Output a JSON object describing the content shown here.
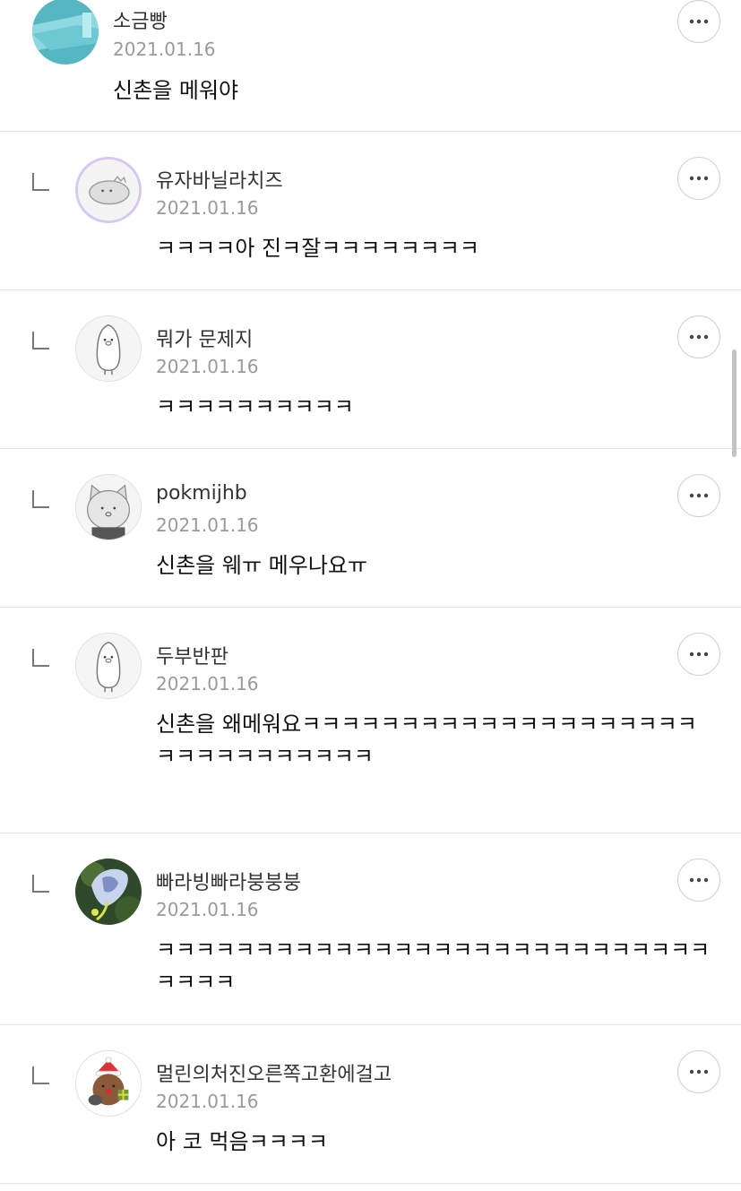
{
  "comments": [
    {
      "username": "소금빵",
      "date": "2021.01.16",
      "text": "신촌을 메워야",
      "avatar_icon": "cloth-photo-avatar",
      "is_reply": false
    },
    {
      "username": "유자바닐라치즈",
      "date": "2021.01.16",
      "text": "ㅋㅋㅋㅋ아 진ㅋ잘ㅋㅋㅋㅋㅋㅋㅋㅋ",
      "avatar_icon": "dinosaur-avatar",
      "is_reply": true
    },
    {
      "username": "뭐가 문제지",
      "date": "2021.01.16",
      "text": "ㅋㅋㅋㅋㅋㅋㅋㅋㅋㅋ",
      "avatar_icon": "penguin-avatar",
      "is_reply": true
    },
    {
      "username": "pokmijhb",
      "date": "2021.01.16",
      "text": "신촌을 웨ㅠ 메우나요ㅠ",
      "avatar_icon": "cat-avatar",
      "is_reply": true
    },
    {
      "username": "두부반판",
      "date": "2021.01.16",
      "text": "신촌을 왜메워요ㅋㅋㅋㅋㅋㅋㅋㅋㅋㅋㅋㅋㅋㅋㅋㅋㅋㅋㅋㅋㅋㅋㅋㅋㅋㅋㅋㅋㅋㅋㅋ",
      "avatar_icon": "penguin-avatar",
      "is_reply": true
    },
    {
      "username": "빠라빙빠라붕붕붕",
      "date": "2021.01.16",
      "text": "ㅋㅋㅋㅋㅋㅋㅋㅋㅋㅋㅋㅋㅋㅋㅋㅋㅋㅋㅋㅋㅋㅋㅋㅋㅋㅋㅋㅋㅋㅋㅋㅋ",
      "avatar_icon": "bird-photo-avatar",
      "is_reply": true
    },
    {
      "username": "멀린의처진오른쪽고환에걸고",
      "date": "2021.01.16",
      "text": "아 코 먹음ㅋㅋㅋㅋ",
      "avatar_icon": "santa-bear-avatar",
      "is_reply": true
    }
  ],
  "more_icon": "more-dots-icon",
  "reply_icon": "reply-arrow-icon",
  "colors": {
    "divider": "#e2e2e2",
    "date": "#9a9a9a",
    "username": "#333333"
  }
}
